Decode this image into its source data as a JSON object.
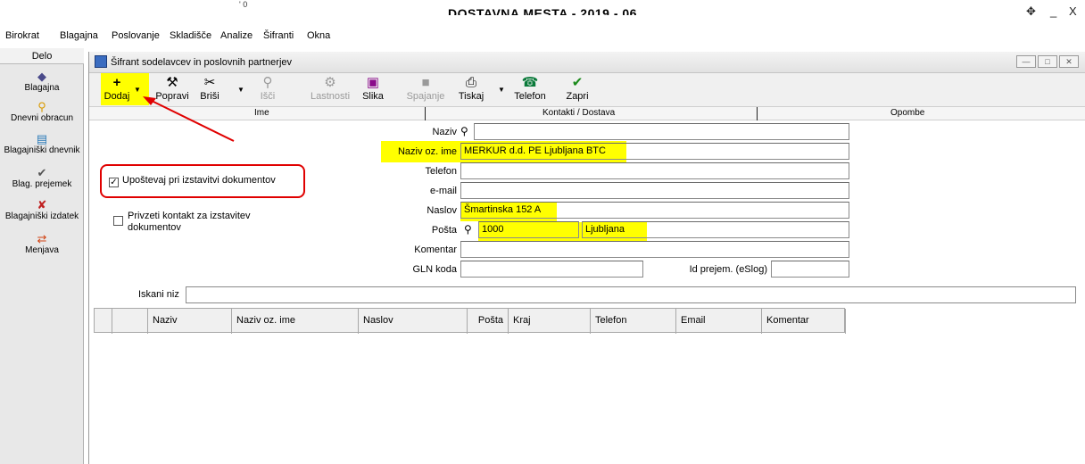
{
  "app": {
    "title": "DOSTAVNA MESTA - 2019 - 06",
    "title_fragment": "' 0"
  },
  "window_controls": {
    "move": "✥",
    "minimize": "_",
    "close": "X"
  },
  "menu": {
    "items": [
      "Birokrat",
      "Blagajna",
      "Poslovanje",
      "Skladišče",
      "Analize",
      "Šifranti",
      "Okna"
    ]
  },
  "left_panel": {
    "header": "Delo",
    "items": [
      {
        "label": "Blagajna",
        "icon": "cash-register-icon"
      },
      {
        "label": "Dnevni obracun",
        "icon": "key-icon"
      },
      {
        "label": "Blagajniški dnevnik",
        "icon": "journal-icon"
      },
      {
        "label": "Blag. prejemek",
        "icon": "receipt-in-icon"
      },
      {
        "label": "Blagajniški izdatek",
        "icon": "receipt-out-icon"
      },
      {
        "label": "Menjava",
        "icon": "exchange-icon"
      }
    ]
  },
  "child_window": {
    "title": "Šifrant sodelavcev in poslovnih partnerjev"
  },
  "toolbar": {
    "dodaj": "Dodaj",
    "popravi": "Popravi",
    "brisi": "Briši",
    "isci": "Išči",
    "lastnosti": "Lastnosti",
    "slika": "Slika",
    "spajanje": "Spajanje",
    "tiskaj": "Tiskaj",
    "telefon": "Telefon",
    "zapri": "Zapri"
  },
  "tabs": {
    "ime": "Ime",
    "kontakti": "Kontakti / Dostava",
    "opombe": "Opombe"
  },
  "form": {
    "naziv_label": "Naziv",
    "naziv_value": "",
    "naziv_oz_ime_label": "Naziv oz. ime",
    "naziv_oz_ime_value": "MERKUR d.d. PE Ljubljana BTC",
    "telefon_label": "Telefon",
    "telefon_value": "",
    "email_label": "e-mail",
    "email_value": "",
    "naslov_label": "Naslov",
    "naslov_value": "Šmartinska 152 A",
    "posta_label": "Pošta",
    "posta_value": "1000",
    "kraj_value": "Ljubljana",
    "komentar_label": "Komentar",
    "komentar_value": "",
    "gln_label": "GLN koda",
    "gln_value": "",
    "id_prejem_label": "Id prejem. (eSlog)",
    "id_prejem_value": ""
  },
  "options": {
    "upostevaj": {
      "label": "Upoštevaj pri izstavitvi dokumentov",
      "checked": true
    },
    "privzeti_line1": "Privzeti kontakt za izstavitev",
    "privzeti_line2": "dokumentov",
    "privzeti_checked": false
  },
  "search": {
    "label": "Iskani niz",
    "value": ""
  },
  "grid": {
    "columns": [
      "Naziv",
      "Naziv oz. ime",
      "Naslov",
      "Pošta",
      "Kraj",
      "Telefon",
      "Email",
      "Komentar"
    ]
  },
  "colors": {
    "highlight": "#ffff00",
    "annotation_red": "#e00000"
  }
}
